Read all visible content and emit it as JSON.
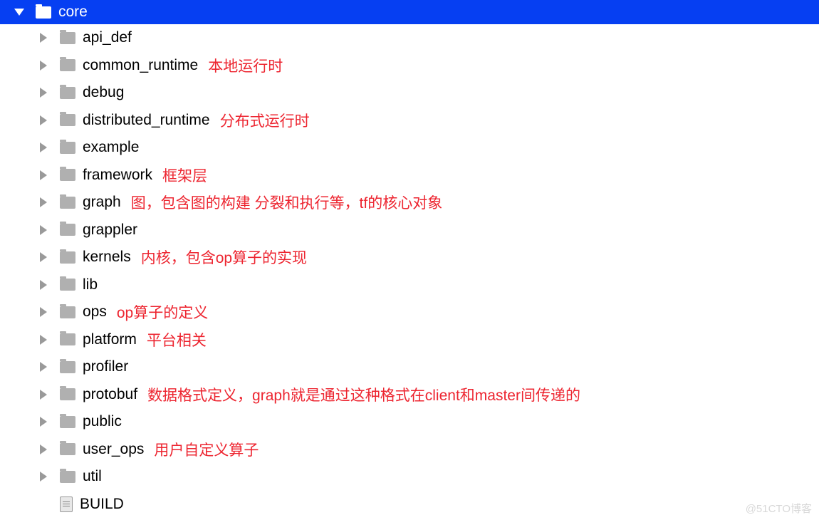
{
  "root": {
    "label": "core"
  },
  "items": [
    {
      "label": "api_def",
      "type": "folder",
      "annotation": ""
    },
    {
      "label": "common_runtime",
      "type": "folder",
      "annotation": "本地运行时"
    },
    {
      "label": "debug",
      "type": "folder",
      "annotation": ""
    },
    {
      "label": "distributed_runtime",
      "type": "folder",
      "annotation": "分布式运行时"
    },
    {
      "label": "example",
      "type": "folder",
      "annotation": ""
    },
    {
      "label": "framework",
      "type": "folder",
      "annotation": "框架层"
    },
    {
      "label": "graph",
      "type": "folder",
      "annotation": "图，包含图的构建 分裂和执行等，tf的核心对象"
    },
    {
      "label": "grappler",
      "type": "folder",
      "annotation": ""
    },
    {
      "label": "kernels",
      "type": "folder",
      "annotation": "内核，包含op算子的实现"
    },
    {
      "label": "lib",
      "type": "folder",
      "annotation": ""
    },
    {
      "label": "ops",
      "type": "folder",
      "annotation": "op算子的定义"
    },
    {
      "label": "platform",
      "type": "folder",
      "annotation": "平台相关"
    },
    {
      "label": "profiler",
      "type": "folder",
      "annotation": ""
    },
    {
      "label": "protobuf",
      "type": "folder",
      "annotation": "数据格式定义，graph就是通过这种格式在client和master间传递的"
    },
    {
      "label": "public",
      "type": "folder",
      "annotation": ""
    },
    {
      "label": "user_ops",
      "type": "folder",
      "annotation": "用户自定义算子"
    },
    {
      "label": "util",
      "type": "folder",
      "annotation": ""
    },
    {
      "label": "BUILD",
      "type": "file",
      "annotation": ""
    }
  ],
  "watermark": "@51CTO博客"
}
